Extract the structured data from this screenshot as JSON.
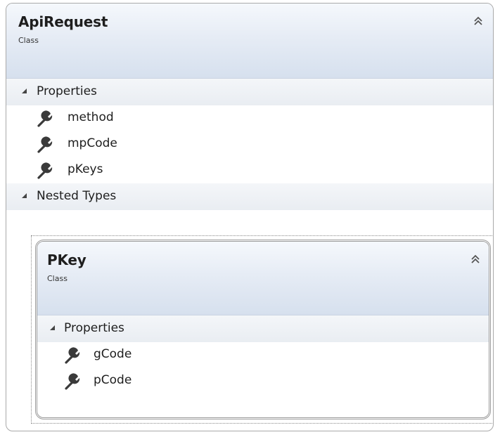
{
  "outer_class": {
    "name": "ApiRequest",
    "kind": "Class",
    "properties_label": "Properties",
    "properties": [
      "method",
      "mpCode",
      "pKeys"
    ],
    "nested_label": "Nested Types"
  },
  "nested_class": {
    "name": "PKey",
    "kind": "Class",
    "properties_label": "Properties",
    "properties": [
      "gCode",
      "pCode"
    ]
  },
  "icons": {
    "collapse": "double-chevron-up-icon",
    "property": "wrench-icon",
    "section_toggle": "triangle-expanded-icon"
  },
  "colors": {
    "header_gradient_top": "#f5f8fc",
    "header_gradient_bottom": "#d6e0ee",
    "section_bg": "#e9edf2",
    "border": "#a9a9a9"
  }
}
